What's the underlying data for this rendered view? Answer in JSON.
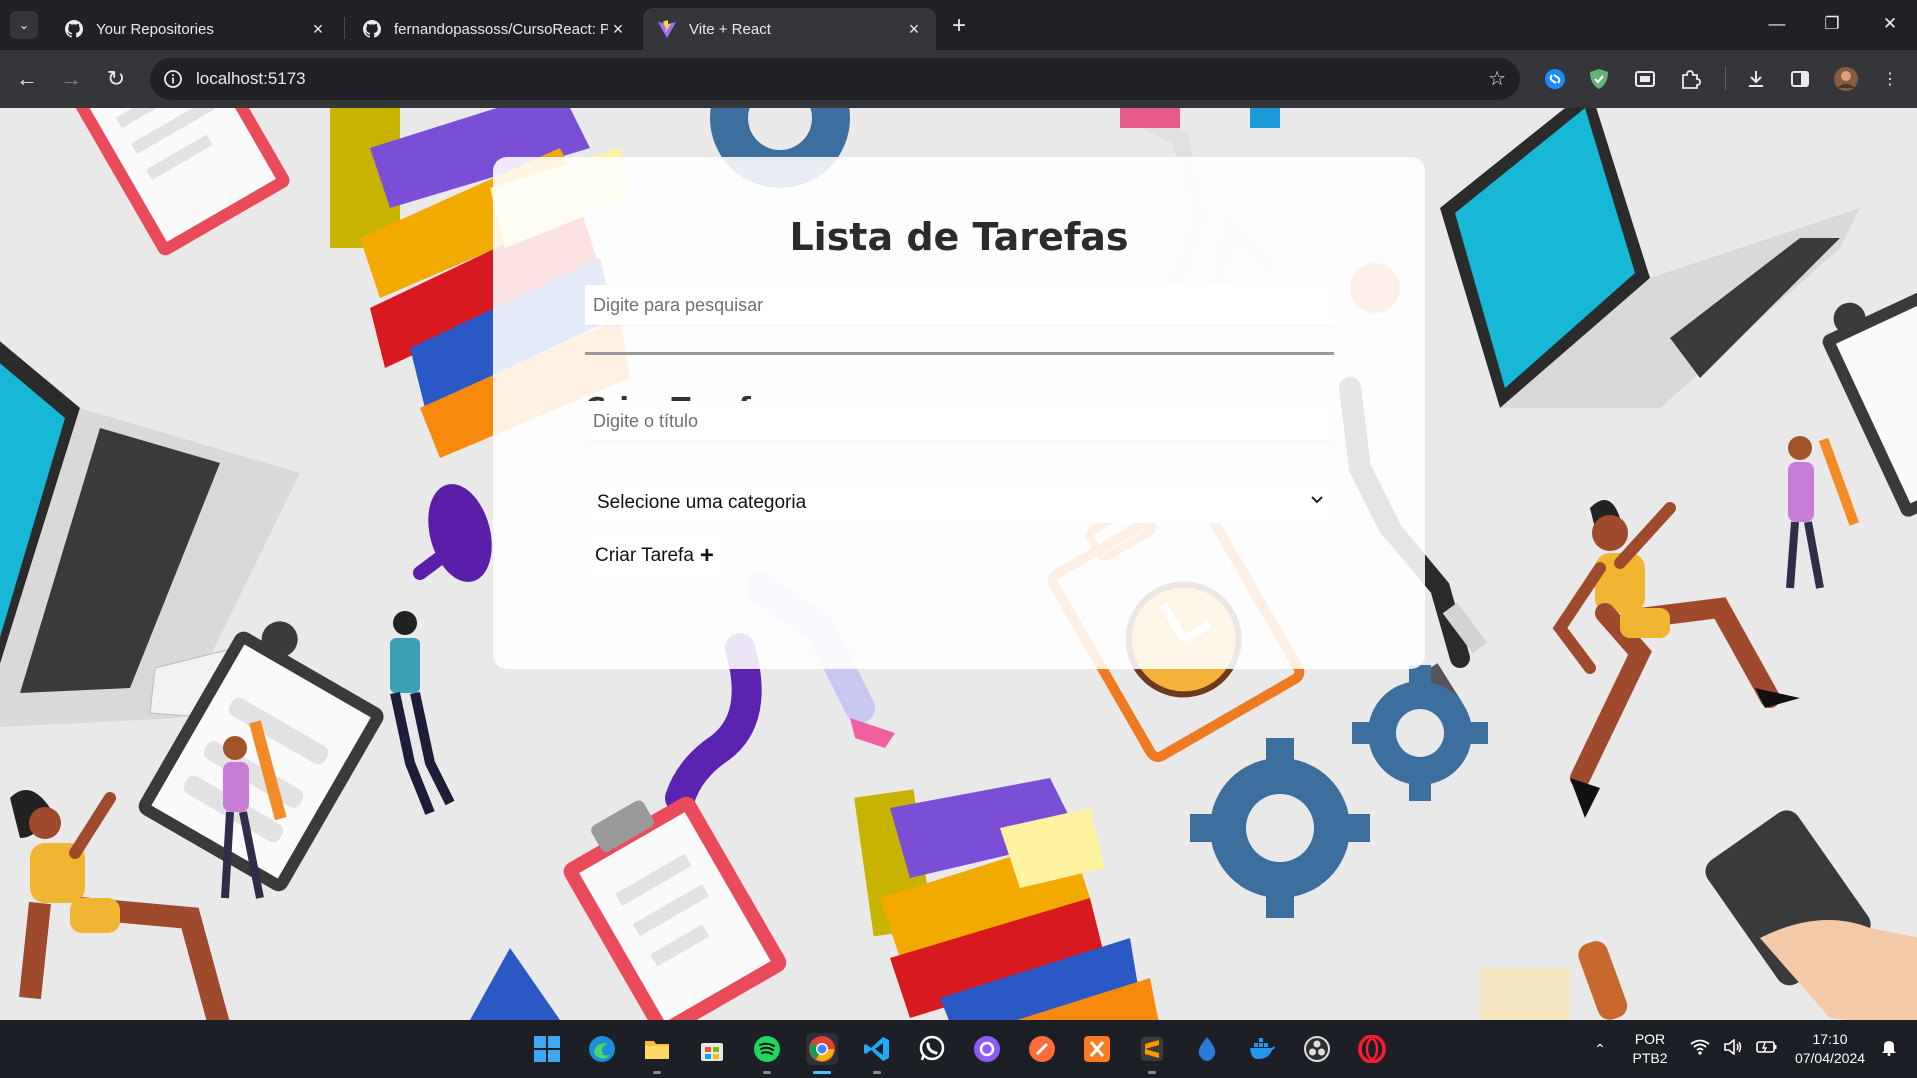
{
  "browser": {
    "tabs": [
      {
        "title": "Your Repositories",
        "icon": "github-icon",
        "active": false
      },
      {
        "title": "fernandopassoss/CursoReact: P",
        "icon": "github-icon",
        "active": false
      },
      {
        "title": "Vite + React",
        "icon": "vite-icon",
        "active": true
      }
    ],
    "url": "localhost:5173"
  },
  "page": {
    "title": "Lista de Tarefas",
    "search_placeholder": "Digite para pesquisar",
    "create_heading": "Criar Tarefa:",
    "title_placeholder": "Digite o título",
    "category_select": "Selecione uma categoria",
    "create_button": "Criar Tarefa",
    "create_button_icon": "+"
  },
  "taskbar": {
    "apps": [
      "windows-start-icon",
      "edge-icon",
      "file-explorer-icon",
      "microsoft-store-icon",
      "spotify-icon",
      "chrome-icon",
      "vscode-icon",
      "whatsapp-icon",
      "github-desktop-icon",
      "postman-icon",
      "xampp-icon",
      "sublime-text-icon",
      "drop-icon",
      "docker-icon",
      "obs-icon",
      "opera-icon"
    ],
    "language": "POR",
    "keyboard": "PTB2",
    "time": "17:10",
    "date": "07/04/2024"
  },
  "colors": {
    "chrome_dark": "#202124",
    "chrome_toolbar": "#35363a",
    "page_background": "#e9e9ea",
    "card_background": "#ffffff",
    "taskbar": "#1c1f26",
    "gear_blue": "#3c6e9e"
  }
}
